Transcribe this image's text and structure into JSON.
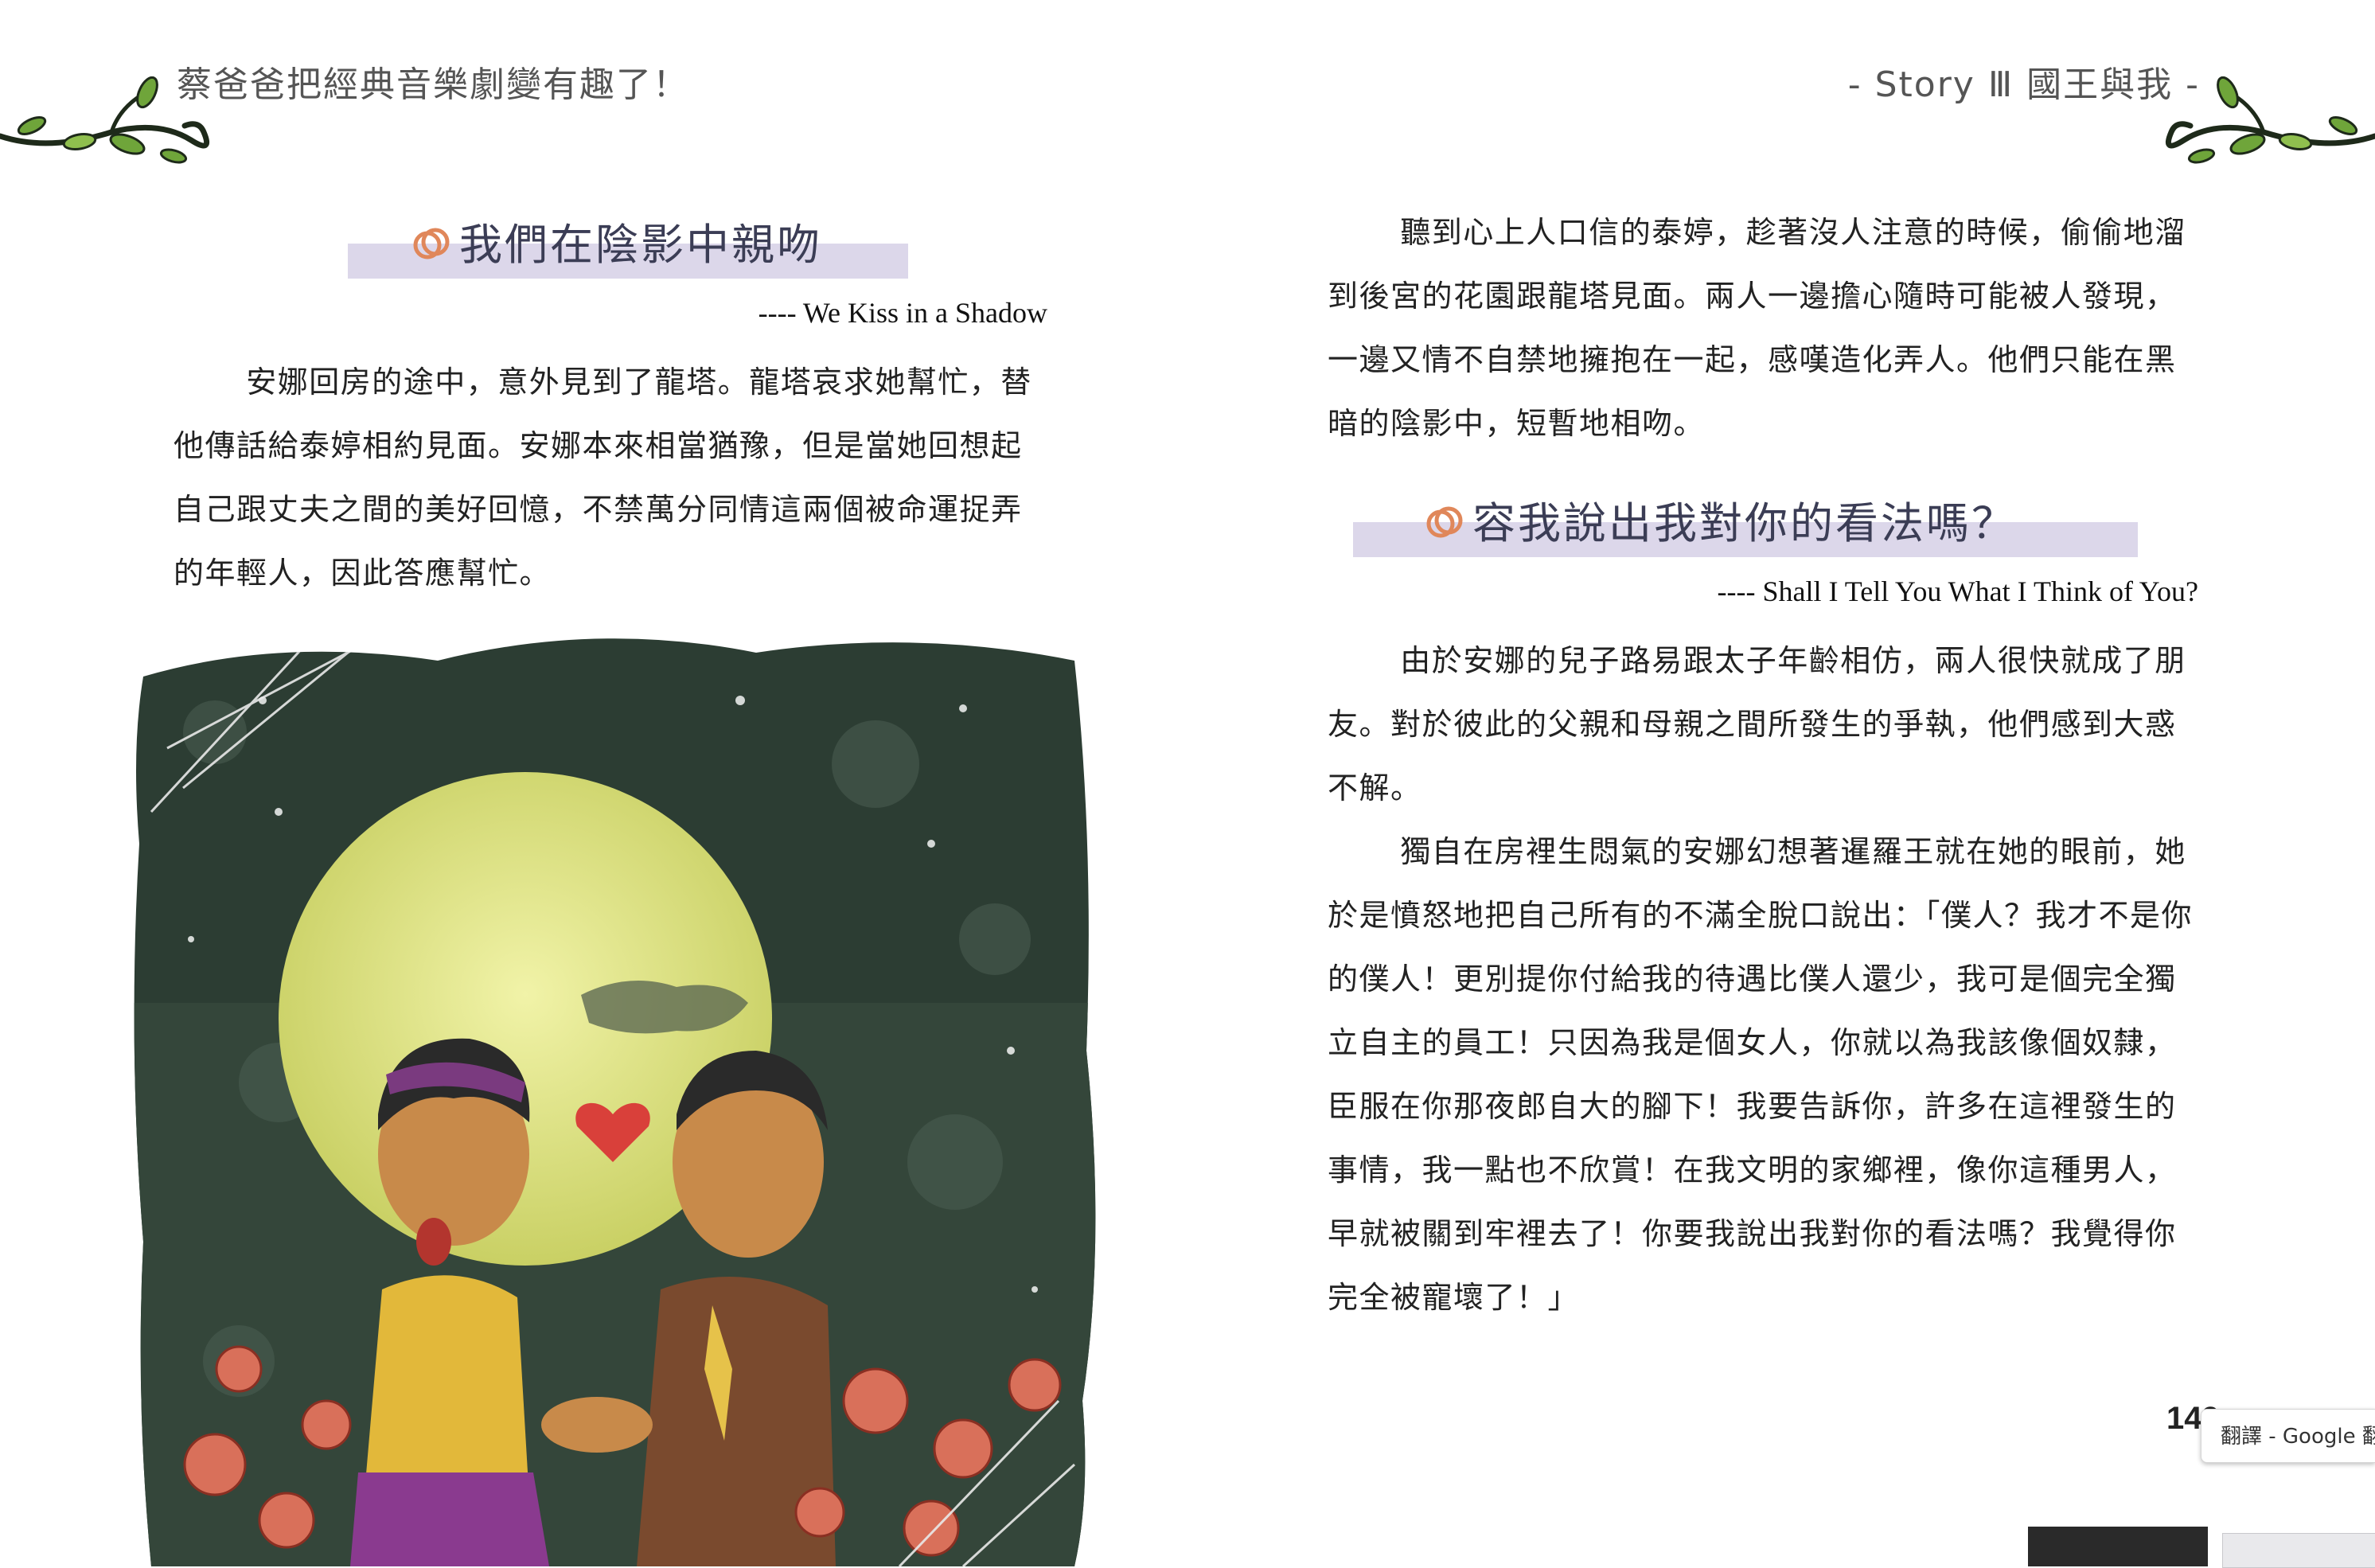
{
  "left_page": {
    "running_head": "蔡爸爸把經典音樂劇變有趣了！",
    "section": {
      "heading": "我們在陰影中親吻",
      "subtitle": "---- We Kiss in a Shadow",
      "paragraphs": [
        "安娜回房的途中，意外見到了龍塔。龍塔哀求她幫忙，替他傳話給泰婷相約見面。安娜本來相當猶豫，但是當她回想起自己跟丈夫之間的美好回憶，不禁萬分同情這兩個被命運捉弄的年輕人，因此答應幫忙。"
      ]
    },
    "illustration_alt": "illustration-moonlit-couple"
  },
  "right_page": {
    "running_head": "- Story Ⅲ 國王與我 -",
    "intro_paragraph": "聽到心上人口信的泰婷，趁著沒人注意的時候，偷偷地溜到後宮的花園跟龍塔見面。兩人一邊擔心隨時可能被人發現，一邊又情不自禁地擁抱在一起，感嘆造化弄人。他們只能在黑暗的陰影中，短暫地相吻。",
    "section": {
      "heading": "容我說出我對你的看法嗎？",
      "subtitle": "---- Shall I Tell You What I Think of You?",
      "paragraphs": [
        "由於安娜的兒子路易跟太子年齡相仿，兩人很快就成了朋友。對於彼此的父親和母親之間所發生的爭執，他們感到大惑不解。",
        "獨自在房裡生悶氣的安娜幻想著暹羅王就在她的眼前，她於是憤怒地把自己所有的不滿全脫口說出：「僕人？我才不是你的僕人！更別提你付給我的待遇比僕人還少，我可是個完全獨立自主的員工！只因為我是個女人，你就以為我該像個奴隸，臣服在你那夜郎自大的腳下！我要告訴你，許多在這裡發生的事情，我一點也不欣賞！在我文明的家鄉裡，像你這種男人，早就被關到牢裡去了！你要我說出我對你的看法嗎？我覺得你完全被寵壞了！」"
      ]
    },
    "page_number": "149"
  },
  "overlay": {
    "translate_chip": "翻譯 - Google 翻"
  },
  "colors": {
    "heading_bar": "#dcd7ea",
    "heading_icon": "#e0875a",
    "vine_green": "#6fa53a",
    "vine_dark": "#1e2a1a",
    "night_sky": "#2c3d33",
    "moon": "#e6ea8a",
    "flower": "#d9705a"
  }
}
